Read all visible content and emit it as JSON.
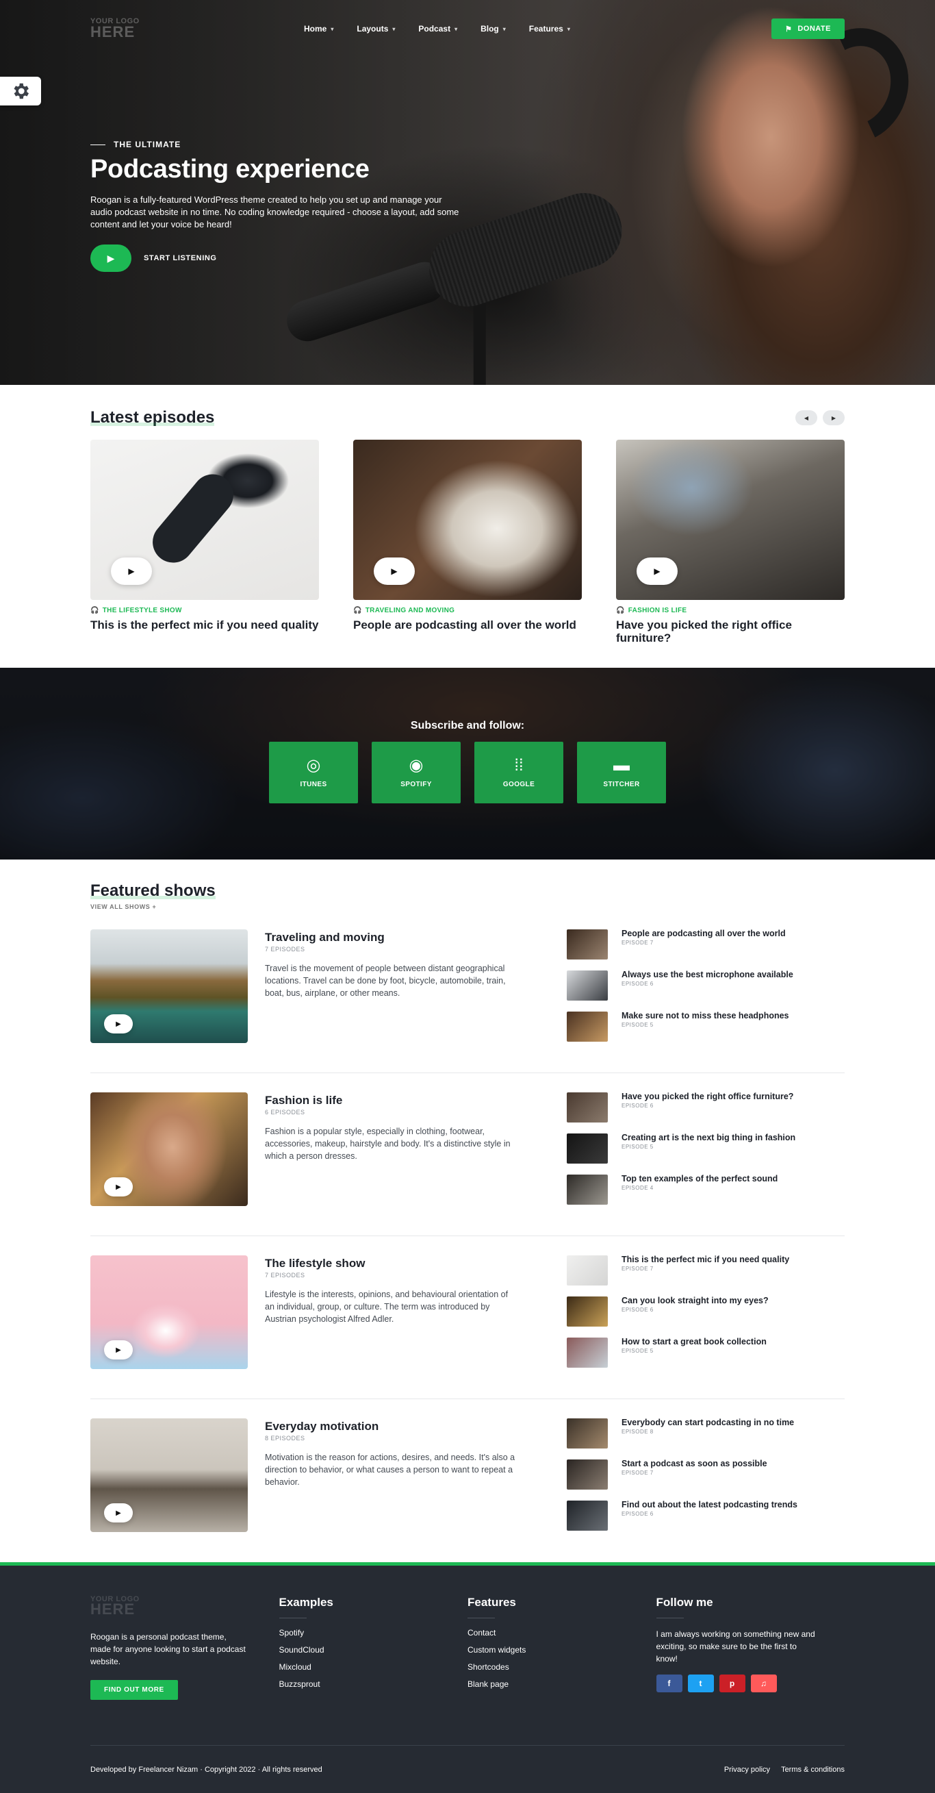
{
  "logo": {
    "line1": "YOUR LOGO",
    "line2": "HERE"
  },
  "nav": {
    "items": [
      {
        "label": "Home"
      },
      {
        "label": "Layouts"
      },
      {
        "label": "Podcast"
      },
      {
        "label": "Blog"
      },
      {
        "label": "Features"
      }
    ],
    "donate_label": "DONATE"
  },
  "hero": {
    "eyebrow": "THE ULTIMATE",
    "title": "Podcasting experience",
    "description": "Roogan is a fully-featured WordPress theme created to help you set up and manage your audio podcast website in no time. No coding knowledge required - choose a layout, add some content and let your voice be heard!",
    "cta": "START LISTENING"
  },
  "latest": {
    "title": "Latest episodes",
    "cards": [
      {
        "category": "THE LIFESTYLE SHOW",
        "title": "This is the perfect mic if you need quality"
      },
      {
        "category": "TRAVELING AND MOVING",
        "title": "People are podcasting all over the world"
      },
      {
        "category": "FASHION IS LIFE",
        "title": "Have you picked the right office furniture?"
      }
    ]
  },
  "subscribe": {
    "title": "Subscribe and follow:",
    "buttons": [
      {
        "label": "ITUNES",
        "icon": "podcast-icon"
      },
      {
        "label": "SPOTIFY",
        "icon": "spotify-icon"
      },
      {
        "label": "GOOGLE",
        "icon": "google-podcasts-icon"
      },
      {
        "label": "STITCHER",
        "icon": "stitcher-icon"
      }
    ]
  },
  "featured": {
    "title": "Featured shows",
    "view_all": "VIEW ALL SHOWS +",
    "shows": [
      {
        "title": "Traveling and moving",
        "count": "7 EPISODES",
        "description": "Travel is the movement of people between distant geographical locations. Travel can be done by foot, bicycle, automobile, train, boat, bus, airplane, or other means.",
        "episodes": [
          {
            "title": "People are podcasting all over the world",
            "num": "EPISODE 7"
          },
          {
            "title": "Always use the best microphone available",
            "num": "EPISODE 6"
          },
          {
            "title": "Make sure not to miss these headphones",
            "num": "EPISODE 5"
          }
        ]
      },
      {
        "title": "Fashion is life",
        "count": "6 EPISODES",
        "description": "Fashion is a popular style, especially in clothing, footwear, accessories, makeup, hairstyle and body. It's a distinctive style in which a person dresses.",
        "episodes": [
          {
            "title": "Have you picked the right office furniture?",
            "num": "EPISODE 6"
          },
          {
            "title": "Creating art is the next big thing in fashion",
            "num": "EPISODE 5"
          },
          {
            "title": "Top ten examples of the perfect sound",
            "num": "EPISODE 4"
          }
        ]
      },
      {
        "title": "The lifestyle show",
        "count": "7 EPISODES",
        "description": "Lifestyle is the interests, opinions, and behavioural orientation of an individual, group, or culture. The term was introduced by Austrian psychologist Alfred Adler.",
        "episodes": [
          {
            "title": "This is the perfect mic if you need quality",
            "num": "EPISODE 7"
          },
          {
            "title": "Can you look straight into my eyes?",
            "num": "EPISODE 6"
          },
          {
            "title": "How to start a great book collection",
            "num": "EPISODE 5"
          }
        ]
      },
      {
        "title": "Everyday motivation",
        "count": "8 EPISODES",
        "description": "Motivation is the reason for actions, desires, and needs. It's also a direction to behavior, or what causes a person to want to repeat a behavior.",
        "episodes": [
          {
            "title": "Everybody can start podcasting in no time",
            "num": "EPISODE 8"
          },
          {
            "title": "Start a podcast as soon as possible",
            "num": "EPISODE 7"
          },
          {
            "title": "Find out about the latest podcasting trends",
            "num": "EPISODE 6"
          }
        ]
      }
    ]
  },
  "footer": {
    "about": "Roogan is a personal podcast theme, made for anyone looking to start a podcast website.",
    "find_out_more": "FIND OUT MORE",
    "col2": {
      "title": "Examples",
      "links": [
        "Spotify",
        "SoundCloud",
        "Mixcloud",
        "Buzzsprout"
      ]
    },
    "col3": {
      "title": "Features",
      "links": [
        "Contact",
        "Custom widgets",
        "Shortcodes",
        "Blank page"
      ]
    },
    "col4": {
      "title": "Follow me",
      "text": "I am always working on something new and exciting, so make sure to be the first to know!"
    },
    "socials": [
      {
        "glyph": "f",
        "icon": "facebook-icon"
      },
      {
        "glyph": "t",
        "icon": "twitter-icon"
      },
      {
        "glyph": "p",
        "icon": "pinterest-icon"
      },
      {
        "glyph": "♫",
        "icon": "music-icon"
      }
    ],
    "credit_prefix": "Developed by",
    "credit_name": "Freelancer Nizam",
    "credit_suffix": "· Copyright 2022 · All rights reserved",
    "privacy": "Privacy policy",
    "terms": "Terms & conditions"
  },
  "colors": {
    "accent": "#1db954",
    "footer_bg": "#262b33"
  }
}
